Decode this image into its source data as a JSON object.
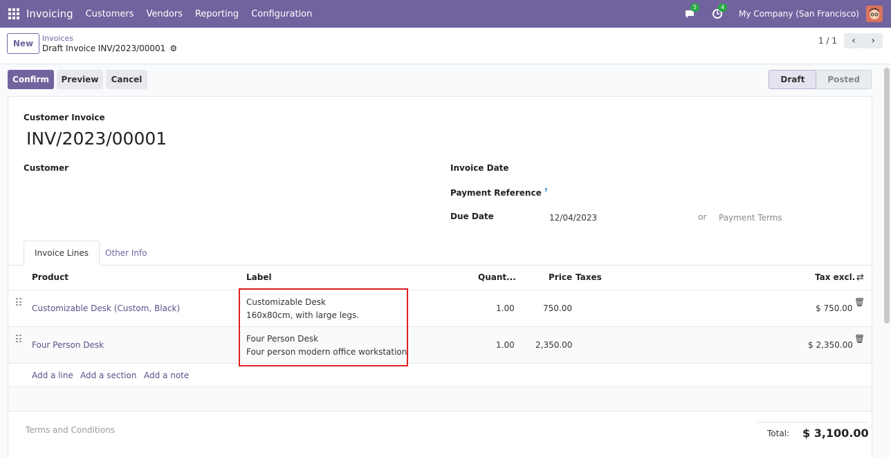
{
  "navbar": {
    "app_name": "Invoicing",
    "menu": [
      "Customers",
      "Vendors",
      "Reporting",
      "Configuration"
    ],
    "messages_count": "5",
    "activities_count": "4",
    "company": "My Company (San Francisco)"
  },
  "control": {
    "new_label": "New",
    "breadcrumb_parent": "Invoices",
    "breadcrumb_current": "Draft Invoice INV/2023/00001",
    "pager": "1 / 1"
  },
  "actions": {
    "confirm": "Confirm",
    "preview": "Preview",
    "cancel": "Cancel"
  },
  "status": {
    "draft": "Draft",
    "posted": "Posted"
  },
  "form": {
    "doc_type": "Customer Invoice",
    "doc_name": "INV/2023/00001",
    "customer_label": "Customer",
    "invoice_date_label": "Invoice Date",
    "payment_ref_label": "Payment Reference",
    "payment_ref_help": "?",
    "due_date_label": "Due Date",
    "due_date_value": "12/04/2023",
    "or_text": "or",
    "payment_terms_placeholder": "Payment Terms"
  },
  "tabs": {
    "invoice_lines": "Invoice Lines",
    "other_info": "Other Info"
  },
  "table": {
    "headers": {
      "product": "Product",
      "label": "Label",
      "quantity": "Quant...",
      "price": "Price",
      "taxes": "Taxes",
      "tax_excl": "Tax excl."
    },
    "rows": [
      {
        "product": "Customizable Desk (Custom, Black)",
        "label_line1": "Customizable Desk",
        "label_line2": "160x80cm, with large legs.",
        "quantity": "1.00",
        "price": "750.00",
        "subtotal": "$ 750.00"
      },
      {
        "product": "Four Person Desk",
        "label_line1": "Four Person Desk",
        "label_line2": "Four person modern office workstation",
        "quantity": "1.00",
        "price": "2,350.00",
        "subtotal": "$ 2,350.00"
      }
    ],
    "add_line": "Add a line",
    "add_section": "Add a section",
    "add_note": "Add a note"
  },
  "footer": {
    "terms_placeholder": "Terms and Conditions",
    "total_label": "Total:",
    "total_value": "$ 3,100.00"
  },
  "colors": {
    "brand": "#71639e",
    "highlight": "#e02020"
  }
}
